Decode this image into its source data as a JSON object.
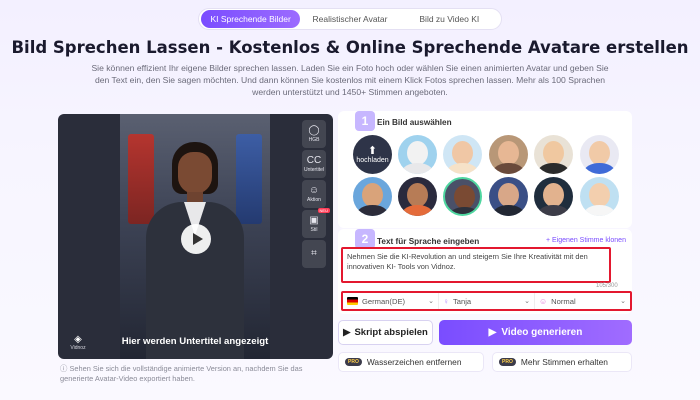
{
  "tabs": [
    "KI Sprechende Bilder",
    "Realistischer Avatar",
    "Bild zu Video KI"
  ],
  "headline": "Bild Sprechen Lassen  -  Kostenlos & Online Sprechende Avatare erstellen",
  "intro": "Sie können effizient Ihr eigene Bilder sprechen lassen. Laden Sie ein Foto hoch oder wählen Sie einen animierten Avatar und geben Sie den Text ein, den Sie sagen möchten. Und dann können Sie kostenlos mit einem Klick Fotos sprechen lassen. Mehr als 100 Sprachen werden unterstützt und 1450+ Stimmen angeboten.",
  "video": {
    "subtitle": "Hier werden Untertitel angezeigt",
    "brand": "Vidnoz",
    "tools": [
      {
        "icon": "HGB",
        "label": "HGB"
      },
      {
        "icon": "CC",
        "label": "Untertitel"
      },
      {
        "icon": "☺",
        "label": "Aktion"
      },
      {
        "icon": "▣",
        "label": "Stil",
        "badge": "NEU"
      },
      {
        "icon": "⌗",
        "label": ""
      }
    ],
    "note": "Sehen Sie sich die vollständige animierte Version an, nachdem Sie das generierte Avatar-Video exportiert haben."
  },
  "step1": {
    "number": "1",
    "label": "Ein Bild auswählen",
    "upload_label": "hochladen"
  },
  "step2": {
    "number": "2",
    "label": "Text für Sprache eingeben",
    "custom_voice": "+ Eigenen Stimme klonen",
    "text": "Nehmen Sie die KI-Revolution an und steigern Sie Ihre Kreativität mit den innovativen KI- Tools von Vidnoz.",
    "counter": "105/300",
    "language": "German(DE)",
    "voice": "Tanja",
    "speed": "Normal"
  },
  "buttons": {
    "play": "Skript abspielen",
    "generate": "Video generieren",
    "pro_tag": "PRO",
    "watermark": "Wasserzeichen entfernen",
    "more_voices": "Mehr Stimmen erhalten"
  },
  "colors": {
    "accent": "#7a4dff",
    "highlight_border": "#e3182f"
  }
}
